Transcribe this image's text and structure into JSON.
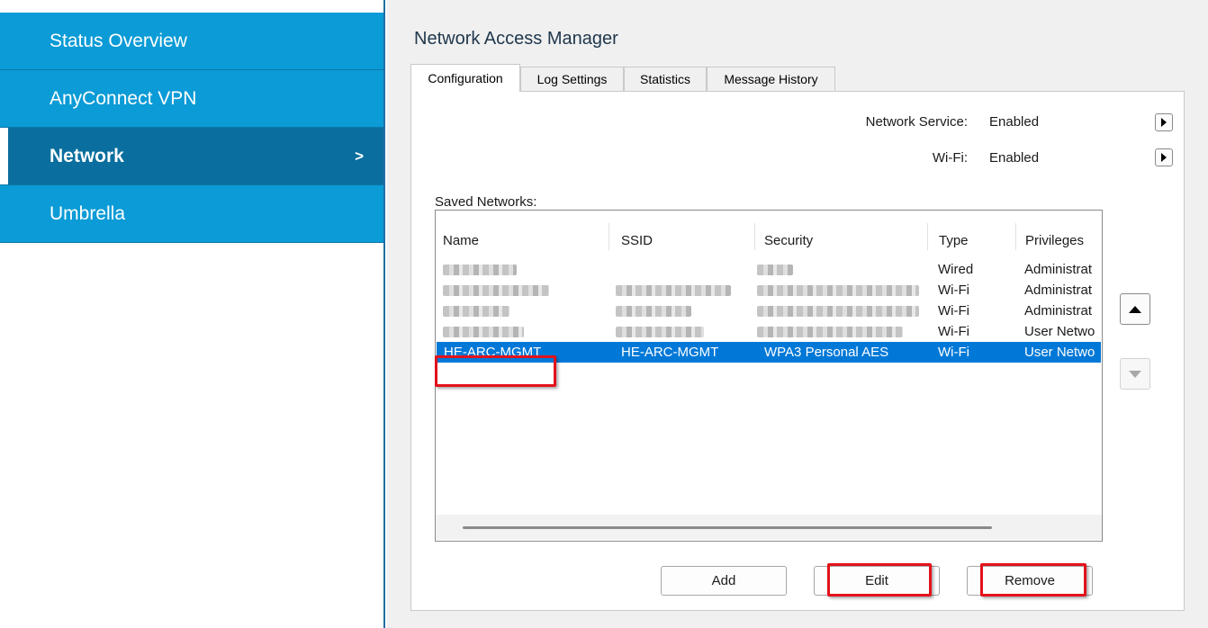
{
  "sidebar": {
    "items": [
      {
        "label": "Status Overview"
      },
      {
        "label": "AnyConnect VPN"
      },
      {
        "label": "Network",
        "chevron": ">"
      },
      {
        "label": "Umbrella"
      }
    ]
  },
  "main": {
    "title": "Network Access Manager",
    "tabs": [
      {
        "label": "Configuration"
      },
      {
        "label": "Log Settings"
      },
      {
        "label": "Statistics"
      },
      {
        "label": "Message History"
      }
    ],
    "network_service": {
      "label": "Network Service:",
      "value": "Enabled"
    },
    "wifi": {
      "label": "Wi-Fi:",
      "value": "Enabled"
    },
    "saved_networks_label": "Saved Networks:",
    "columns": [
      "Name",
      "SSID",
      "Security",
      "Type",
      "Privileges"
    ],
    "rows": [
      {
        "name": "",
        "ssid": "",
        "security": "",
        "type": "Wired",
        "privileges": "Administrat",
        "redacted": true
      },
      {
        "name": "",
        "ssid": "",
        "security": "",
        "type": "Wi-Fi",
        "privileges": "Administrat",
        "redacted": true
      },
      {
        "name": "",
        "ssid": "",
        "security": "",
        "type": "Wi-Fi",
        "privileges": "Administrat",
        "redacted": true
      },
      {
        "name": "",
        "ssid": "",
        "security": "",
        "type": "Wi-Fi",
        "privileges": "User Netwo",
        "redacted": true
      },
      {
        "name": "HE-ARC-MGMT",
        "ssid": "HE-ARC-MGMT",
        "security": "WPA3 Personal AES",
        "type": "Wi-Fi",
        "privileges": "User Netwo",
        "selected": true
      }
    ],
    "buttons": {
      "add": "Add",
      "edit": "Edit",
      "remove": "Remove"
    }
  },
  "icons": {
    "expand": "triangle-right-icon",
    "move_up": "triangle-up-icon",
    "move_down": "triangle-down-icon"
  },
  "colors": {
    "sidebar_bg": "#0b9bd6",
    "sidebar_active_bg": "#0a6e9e",
    "selection": "#0078d7",
    "highlight": "#e3121b"
  }
}
